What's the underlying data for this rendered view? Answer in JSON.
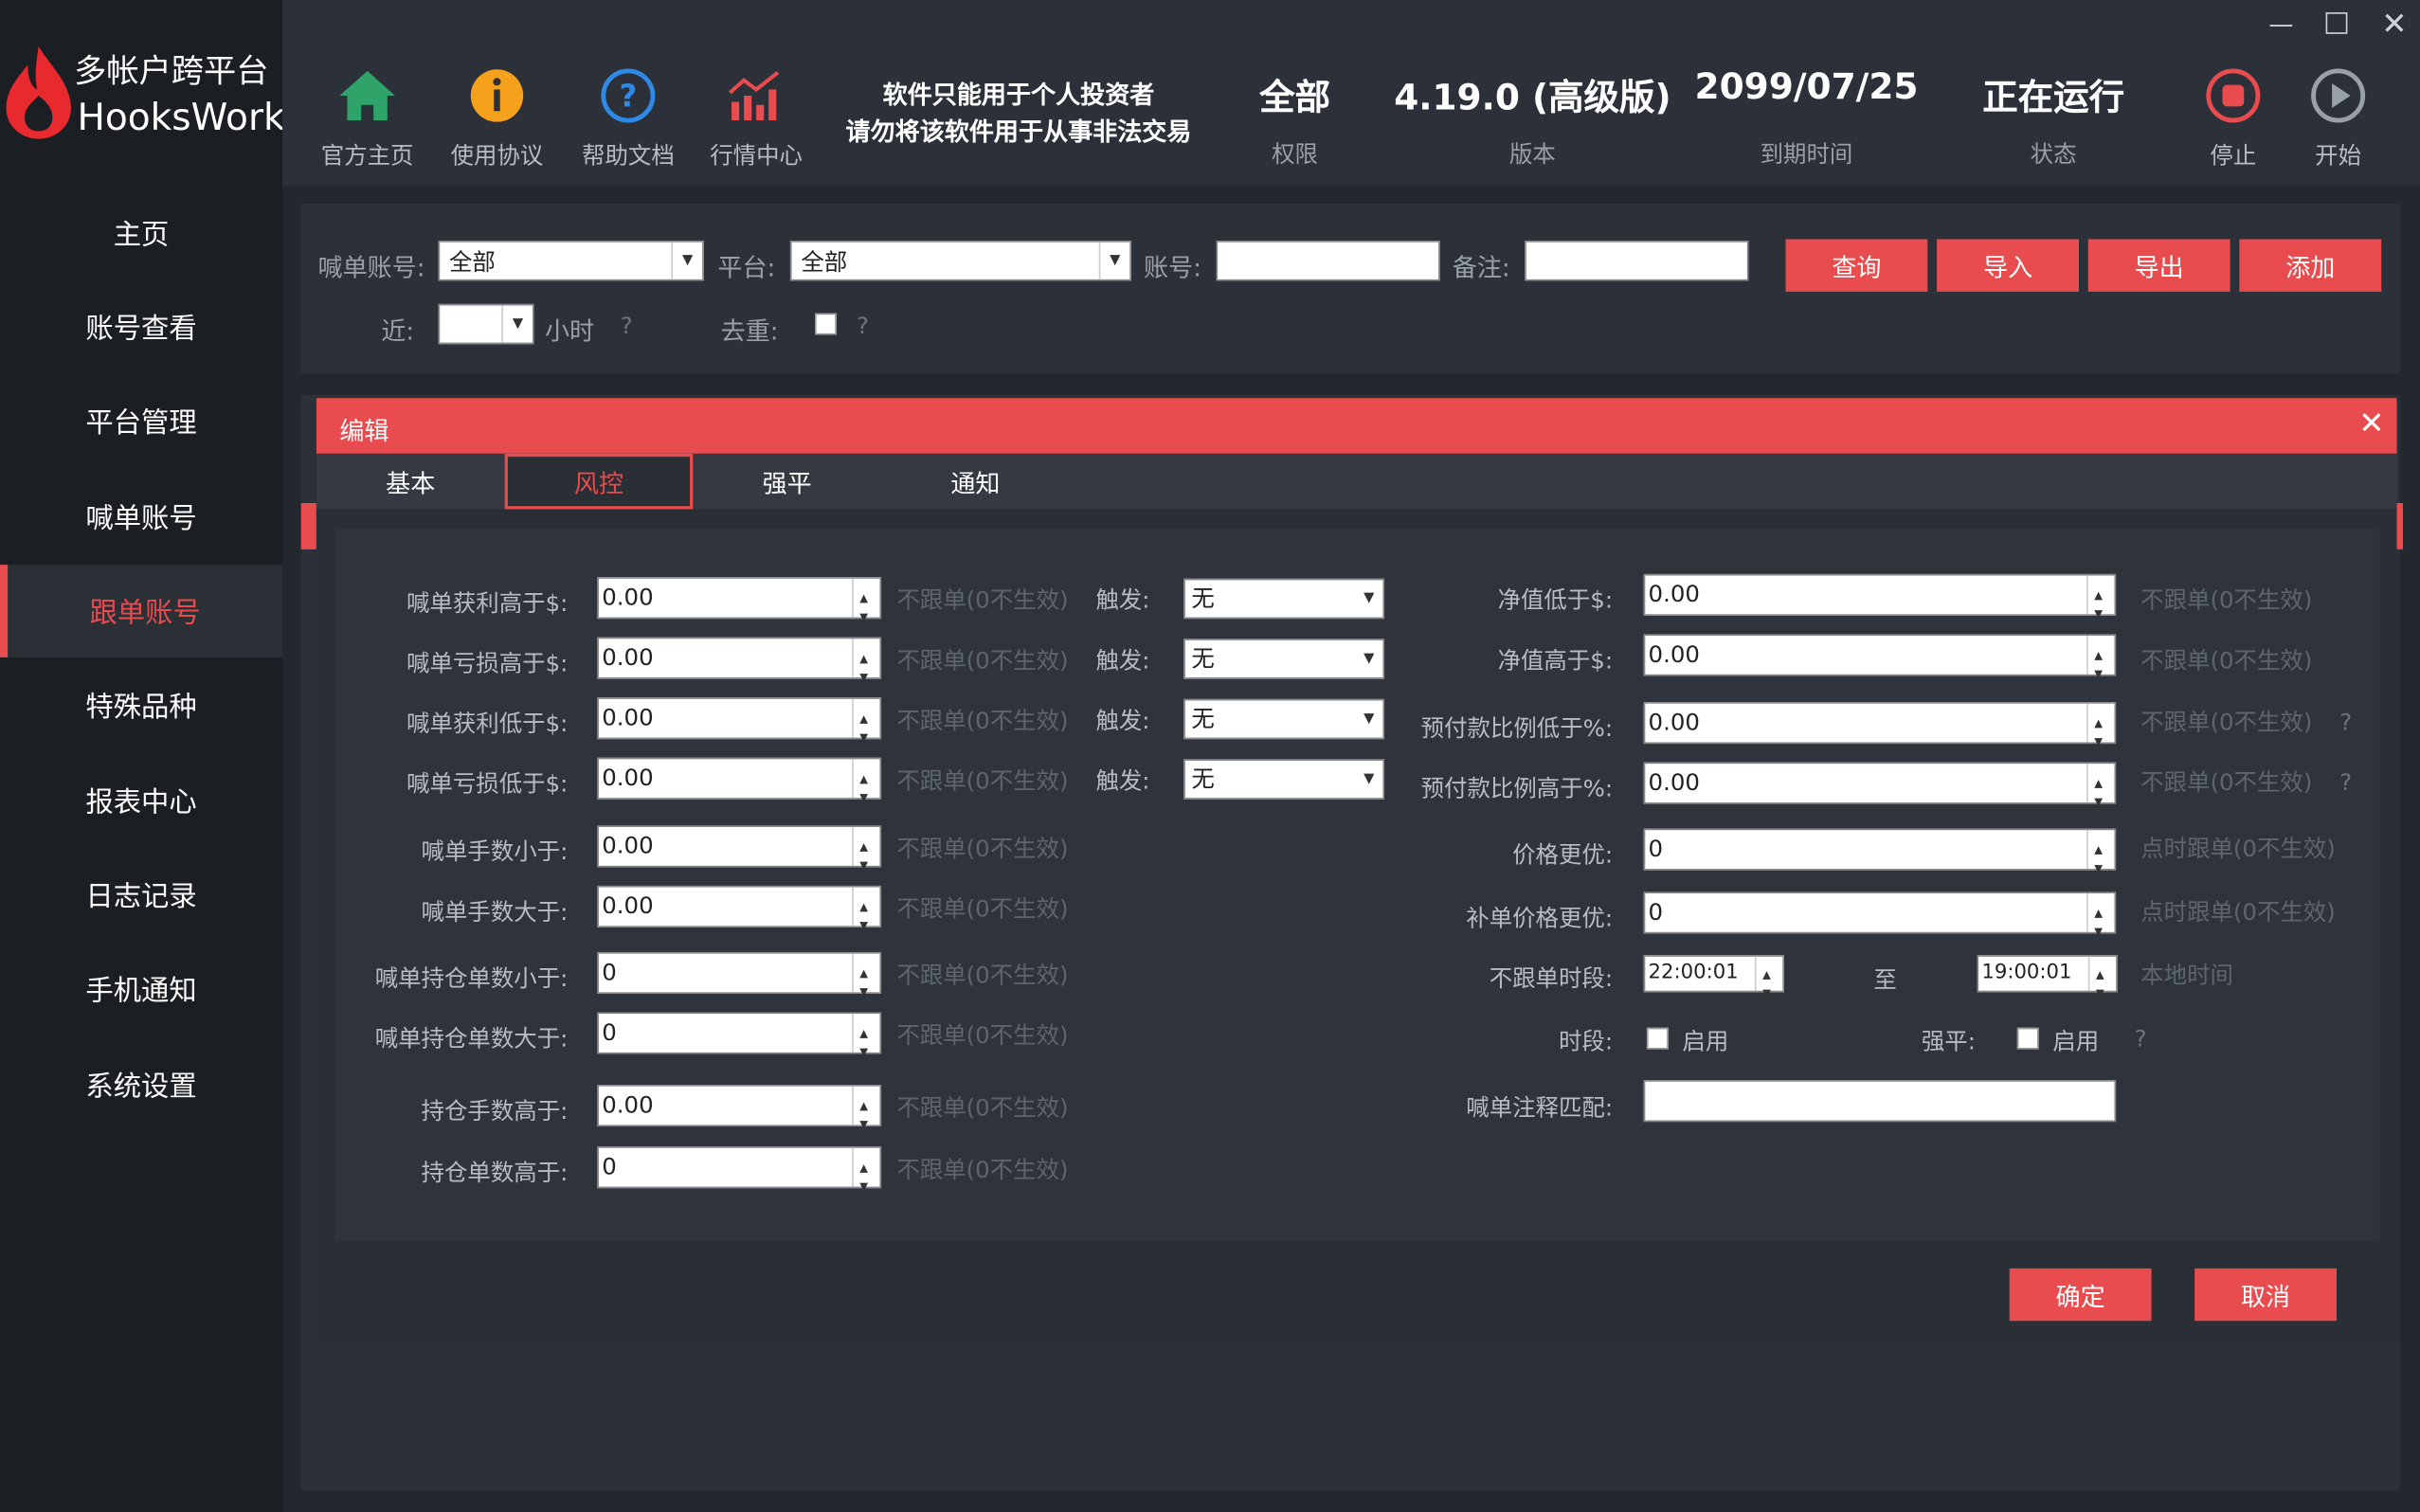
{
  "app": {
    "title_cn": "多帐户跨平台",
    "title_en": "HooksWork"
  },
  "sidebar": {
    "items": [
      {
        "label": "主页"
      },
      {
        "label": "账号查看"
      },
      {
        "label": "平台管理"
      },
      {
        "label": "喊单账号"
      },
      {
        "label": "跟单账号"
      },
      {
        "label": "特殊品种"
      },
      {
        "label": "报表中心"
      },
      {
        "label": "日志记录"
      },
      {
        "label": "手机通知"
      },
      {
        "label": "系统设置"
      }
    ],
    "active_index": 4
  },
  "toolbar": {
    "home": "官方主页",
    "agreement": "使用协议",
    "help": "帮助文档",
    "market": "行情中心",
    "notice_line1": "软件只能用于个人投资者",
    "notice_line2": "请勿将该软件用于从事非法交易",
    "permission_value": "全部",
    "permission_label": "权限",
    "version_value": "4.19.0 (高级版)",
    "version_label": "版本",
    "expiry_value": "2099/07/25",
    "expiry_label": "到期时间",
    "status_value": "正在运行",
    "status_label": "状态",
    "stop": "停止",
    "start": "开始"
  },
  "filter": {
    "signal_account_label": "喊单账号:",
    "signal_account_value": "全部",
    "platform_label": "平台:",
    "platform_value": "全部",
    "account_label": "账号:",
    "account_value": "",
    "remark_label": "备注:",
    "remark_value": "",
    "recent_label": "近:",
    "recent_value": "",
    "hours_label": "小时",
    "dedup_label": "去重:",
    "qmark": "?",
    "query": "查询",
    "import": "导入",
    "export": "导出",
    "add": "添加"
  },
  "dialog": {
    "title": "编辑",
    "tabs": [
      {
        "label": "基本"
      },
      {
        "label": "风控"
      },
      {
        "label": "强平"
      },
      {
        "label": "通知"
      }
    ],
    "active_tab": 1,
    "left_rows": [
      {
        "label": "喊单获利高于$:",
        "value": "0.00",
        "hint": "不跟单(0不生效)",
        "trigger_label": "触发:",
        "trigger_value": "无"
      },
      {
        "label": "喊单亏损高于$:",
        "value": "0.00",
        "hint": "不跟单(0不生效)",
        "trigger_label": "触发:",
        "trigger_value": "无"
      },
      {
        "label": "喊单获利低于$:",
        "value": "0.00",
        "hint": "不跟单(0不生效)",
        "trigger_label": "触发:",
        "trigger_value": "无"
      },
      {
        "label": "喊单亏损低于$:",
        "value": "0.00",
        "hint": "不跟单(0不生效)",
        "trigger_label": "触发:",
        "trigger_value": "无"
      },
      {
        "label": "喊单手数小于:",
        "value": "0.00",
        "hint": "不跟单(0不生效)"
      },
      {
        "label": "喊单手数大于:",
        "value": "0.00",
        "hint": "不跟单(0不生效)"
      },
      {
        "label": "喊单持仓单数小于:",
        "value": "0",
        "hint": "不跟单(0不生效)"
      },
      {
        "label": "喊单持仓单数大于:",
        "value": "0",
        "hint": "不跟单(0不生效)"
      },
      {
        "label": "持仓手数高于:",
        "value": "0.00",
        "hint": "不跟单(0不生效)"
      },
      {
        "label": "持仓单数高于:",
        "value": "0",
        "hint": "不跟单(0不生效)"
      }
    ],
    "right_rows": [
      {
        "label": "净值低于$:",
        "value": "0.00",
        "hint": "不跟单(0不生效)"
      },
      {
        "label": "净值高于$:",
        "value": "0.00",
        "hint": "不跟单(0不生效)"
      },
      {
        "label": "预付款比例低于%:",
        "value": "0.00",
        "hint": "不跟单(0不生效)"
      },
      {
        "label": "预付款比例高于%:",
        "value": "0.00",
        "hint": "不跟单(0不生效)"
      },
      {
        "label": "价格更优:",
        "value": "0",
        "hint": "点时跟单(0不生效)"
      },
      {
        "label": "补单价格更优:",
        "value": "0",
        "hint": "点时跟单(0不生效)"
      }
    ],
    "no_follow_period_label": "不跟单时段:",
    "time_from": "22:00:01",
    "to_label": "至",
    "time_to": "19:00:01",
    "local_time": "本地时间",
    "period_label": "时段:",
    "period_enable": "启用",
    "force_label": "强平:",
    "force_enable": "启用",
    "comment_match_label": "喊单注释匹配:",
    "comment_match_value": "",
    "qmark": "?",
    "ok": "确定",
    "cancel": "取消"
  },
  "colors": {
    "accent": "#e84c4f",
    "sidebar_bg": "#1b1e23",
    "panel_bg": "#2c3038"
  }
}
